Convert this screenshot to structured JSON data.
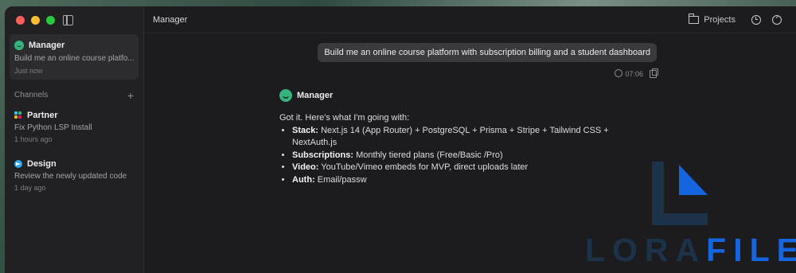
{
  "sidebar": {
    "active_conversation": {
      "name": "Manager",
      "preview": "Build me an online course platfo...",
      "time": "Just now"
    },
    "channels_label": "Channels",
    "add_icon": "plus-icon",
    "channels": [
      {
        "name": "Partner",
        "icon": "slack-icon",
        "preview": "Fix Python LSP Install",
        "time": "1 hours ago"
      },
      {
        "name": "Design",
        "icon": "telegram-icon",
        "preview": "Review the newly updated code",
        "time": "1 day ago"
      }
    ]
  },
  "header": {
    "title": "Manager",
    "projects_label": "Projects"
  },
  "chat": {
    "user_message": "Build me an online course platform with subscription billing and a student dashboard",
    "user_time": "07:06",
    "assistant_name": "Manager",
    "intro": "Got it. Here's what I'm going with:",
    "bullets": [
      {
        "label": "Stack:",
        "text": " Next.js 14 (App Router) + PostgreSQL + Prisma + Stripe + Tailwind CSS + NextAuth.js"
      },
      {
        "label": "Subscriptions:",
        "text": " Monthly tiered plans (Free/Basic /Pro)"
      },
      {
        "label": "Video:",
        "text": " YouTube/Vimeo embeds for MVP, direct uploads later"
      },
      {
        "label": "Auth:",
        "text": " Email/passw"
      }
    ]
  },
  "watermark": {
    "text_dark": "LORA",
    "text_blue": "FILE"
  }
}
